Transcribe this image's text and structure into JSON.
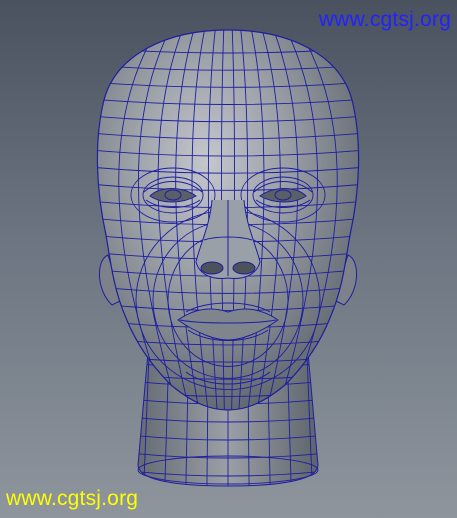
{
  "viewport": {
    "background_top": "#4a5260",
    "background_bottom": "#8e959d"
  },
  "model": {
    "name": "head-mesh",
    "surface_color": "#8a8f96",
    "wire_color": "#1e1e9e"
  },
  "watermarks": {
    "top": {
      "text": "www.cgtsj.org",
      "color": "#2222ff"
    },
    "bottom": {
      "text": "www.cgtsj.org",
      "color": "#ffff00"
    }
  }
}
